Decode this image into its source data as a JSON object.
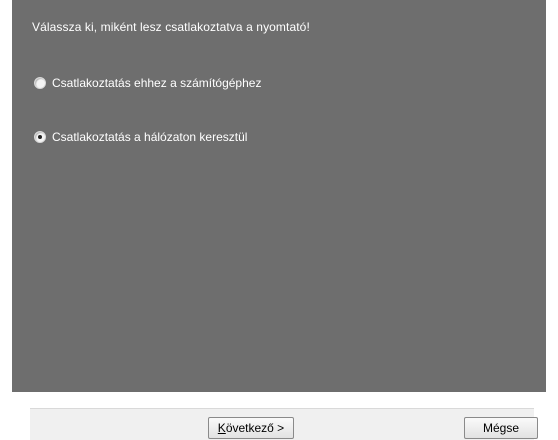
{
  "dialog": {
    "prompt": "Válassza ki, miként lesz csatlakoztatva a nyomtató!",
    "options": [
      {
        "label": "Csatlakoztatás ehhez a számítógéphez",
        "selected": false
      },
      {
        "label": "Csatlakoztatás a hálózaton keresztül",
        "selected": true
      }
    ]
  },
  "buttons": {
    "next_mnemonic": "K",
    "next_rest": "övetkező >",
    "cancel_label": "Mégse"
  }
}
